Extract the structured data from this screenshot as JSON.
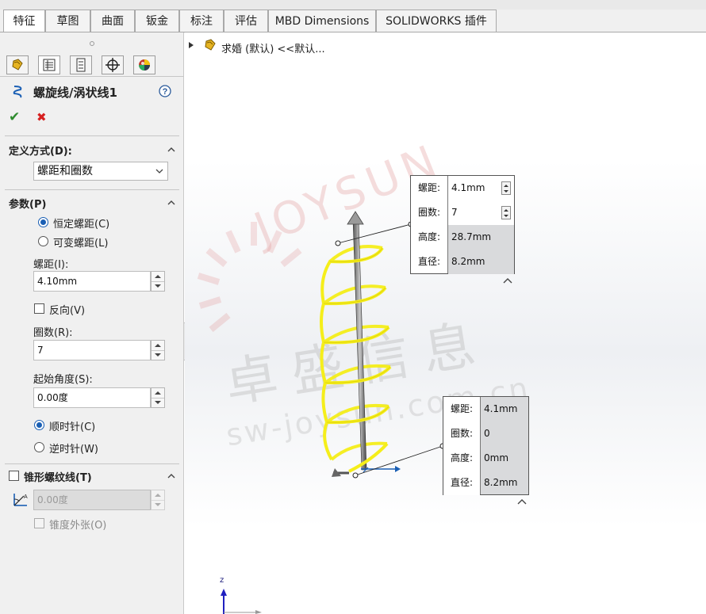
{
  "tabs": [
    {
      "label": "特征",
      "active": true
    },
    {
      "label": "草图"
    },
    {
      "label": "曲面"
    },
    {
      "label": "钣金"
    },
    {
      "label": "标注"
    },
    {
      "label": "评估"
    },
    {
      "label": "MBD Dimensions"
    },
    {
      "label": "SOLIDWORKS 插件"
    }
  ],
  "feature": {
    "title": "螺旋线/涡状线1",
    "ok_symbol": "✔",
    "cancel_symbol": "✖"
  },
  "definition": {
    "title": "定义方式(D):",
    "selected": "螺距和圈数"
  },
  "params": {
    "title": "参数(P)",
    "constant_pitch": "恒定螺距(C)",
    "variable_pitch": "可变螺距(L)",
    "pitch_label": "螺距(I):",
    "pitch_value": "4.10mm",
    "reverse_label": "反向(V)",
    "revolutions_label": "圈数(R):",
    "revolutions_value": "7",
    "start_angle_label": "起始角度(S):",
    "start_angle_value": "0.00度",
    "clockwise": "顺时针(C)",
    "counterclockwise": "逆时针(W)"
  },
  "taper": {
    "title": "锥形螺纹线(T)",
    "angle_value": "0.00度",
    "taper_outward": "锥度外张(O)"
  },
  "tree": {
    "root_label": "求婚 (默认) <<默认..."
  },
  "callout_top": {
    "rows": [
      {
        "key": "螺距:",
        "value": "4.1mm",
        "grey": false
      },
      {
        "key": "圈数:",
        "value": "7",
        "grey": false
      },
      {
        "key": "高度:",
        "value": "28.7mm",
        "grey": true
      },
      {
        "key": "直径:",
        "value": "8.2mm",
        "grey": true
      }
    ]
  },
  "callout_bottom": {
    "rows": [
      {
        "key": "螺距:",
        "value": "4.1mm"
      },
      {
        "key": "圈数:",
        "value": "0"
      },
      {
        "key": "高度:",
        "value": "0mm"
      },
      {
        "key": "直径:",
        "value": "8.2mm"
      }
    ]
  },
  "watermark": {
    "brand": "JOYSUN",
    "cn_text": "卓盛信息",
    "url": "sw-joysun.com.cn"
  },
  "triad": {
    "z_label": "z"
  },
  "colors": {
    "helix": "#f5ee1a",
    "accent": "#1a5fb4",
    "ok": "#2e8b2e",
    "cancel": "#d62020"
  }
}
